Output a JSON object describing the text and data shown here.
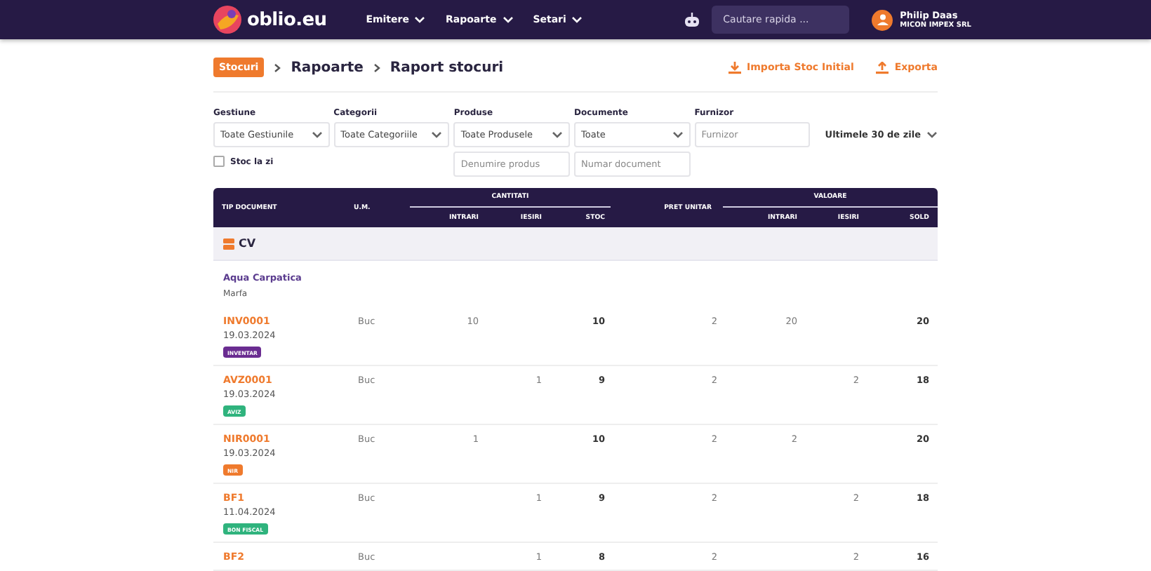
{
  "navbar": {
    "logo": "oblio.eu",
    "menu": [
      {
        "label": "Emitere"
      },
      {
        "label": "Rapoarte"
      },
      {
        "label": "Setari"
      }
    ],
    "search": {
      "placeholder": "Cautare rapida ..."
    },
    "user": {
      "name": "Philip Daas",
      "company": "MICON IMPEX SRL"
    }
  },
  "breadcrumb": {
    "badge": "Stocuri",
    "items": [
      "Rapoarte",
      "Raport stocuri"
    ]
  },
  "actions": [
    {
      "label": "Importa Stoc Initial",
      "kind": "download"
    },
    {
      "label": "Exporta",
      "kind": "upload"
    }
  ],
  "filters": {
    "gestiune": {
      "label": "Gestiune",
      "value": "Toate Gestiunile"
    },
    "categorii": {
      "label": "Categorii",
      "value": "Toate Categoriile"
    },
    "produse": {
      "label": "Produse",
      "value": "Toate Produsele",
      "placeholder": "Denumire produs"
    },
    "documente": {
      "label": "Documente",
      "value": "Toate",
      "placeholder": "Numar document"
    },
    "furnizor": {
      "label": "Furnizor",
      "placeholder": "Furnizor"
    },
    "period": "Ultimele 30 de zile",
    "stoc_la_zi": {
      "label": "Stoc la zi",
      "checked": false
    }
  },
  "table": {
    "header": {
      "tip_document": "TIP DOCUMENT",
      "um": "U.M.",
      "cantitati": "CANTITATI",
      "pret_unitar": "PRET UNITAR",
      "valoare": "VALOARE",
      "cantitati_columns": [
        "INTRARI",
        "IESIRI",
        "STOC"
      ],
      "valoare_columns": [
        "INTRARI",
        "IESIRI",
        "SOLD"
      ]
    },
    "rows": [
      {
        "kind": "group",
        "label": "CV"
      },
      {
        "kind": "product",
        "name": "Aqua Carpatica",
        "category": "Marfa"
      },
      {
        "kind": "document",
        "number": "INV0001",
        "date": "19.03.2024",
        "tag": "INVENTAR",
        "color": "#6a2c91",
        "um": "Buc",
        "qty_in": "10",
        "qty_out": "",
        "stock": "10",
        "unit_price": "2",
        "val_in": "20",
        "val_out": "",
        "balance": "20"
      },
      {
        "kind": "document",
        "number": "AVZ0001",
        "date": "19.03.2024",
        "tag": "AVIZ",
        "color": "#2fb37d",
        "um": "Buc",
        "qty_in": "",
        "qty_out": "1",
        "stock": "9",
        "unit_price": "2",
        "val_in": "",
        "val_out": "2",
        "balance": "18"
      },
      {
        "kind": "document",
        "number": "NIR0001",
        "date": "19.03.2024",
        "tag": "NIR",
        "color": "#ef7a2d",
        "um": "Buc",
        "qty_in": "1",
        "qty_out": "",
        "stock": "10",
        "unit_price": "2",
        "val_in": "2",
        "val_out": "",
        "balance": "20"
      },
      {
        "kind": "document",
        "number": "BF1",
        "date": "11.04.2024",
        "tag": "BON FISCAL",
        "color": "#2fb37d",
        "um": "Buc",
        "qty_in": "",
        "qty_out": "1",
        "stock": "9",
        "unit_price": "2",
        "val_in": "",
        "val_out": "2",
        "balance": "18"
      },
      {
        "kind": "document",
        "number": "BF2",
        "um": "Buc",
        "qty_in": "",
        "qty_out": "1",
        "stock": "8",
        "unit_price": "2",
        "val_in": "",
        "val_out": "2",
        "balance": "16"
      }
    ]
  }
}
